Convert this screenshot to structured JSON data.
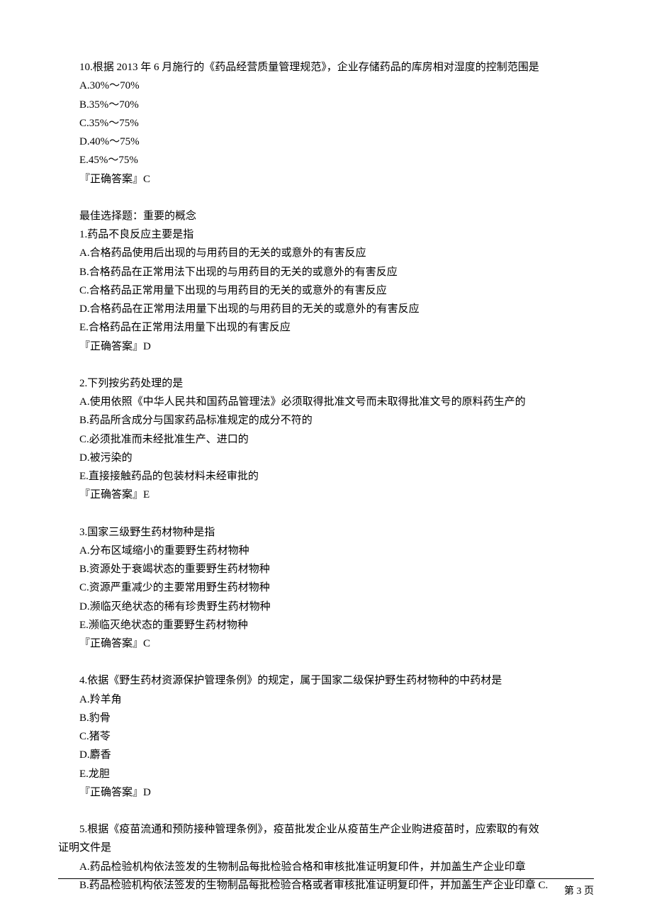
{
  "q10": {
    "stem": "10.根据 2013 年 6 月施行的《药品经营质量管理规范》，企业存储药品的库房相对湿度的控制范围是",
    "a": "A.30%～70%",
    "b": "B.35%～70%",
    "c": "C.35%～75%",
    "d": "D.40%～75%",
    "e": "E.45%～75%",
    "ans": "『正确答案』C"
  },
  "section_header": "最佳选择题：重要的概念",
  "q1": {
    "stem": "1.药品不良反应主要是指",
    "a": "A.合格药品使用后出现的与用药目的无关的或意外的有害反应",
    "b": "B.合格药品在正常用法下出现的与用药目的无关的或意外的有害反应",
    "c": "C.合格药品正常用量下出现的与用药目的无关的或意外的有害反应",
    "d": "D.合格药品在正常用法用量下出现的与用药目的无关的或意外的有害反应",
    "e": "E.合格药品在正常用法用量下出现的有害反应",
    "ans": "『正确答案』D"
  },
  "q2": {
    "stem": "2.下列按劣药处理的是",
    "a": "A.使用依照《中华人民共和国药品管理法》必须取得批准文号而未取得批准文号的原料药生产的",
    "b": "B.药品所含成分与国家药品标准规定的成分不符的",
    "c": "C.必须批准而未经批准生产、进口的",
    "d": "D.被污染的",
    "e": "E.直接接触药品的包装材料未经审批的",
    "ans": "『正确答案』E"
  },
  "q3": {
    "stem": "3.国家三级野生药材物种是指",
    "a": "A.分布区域缩小的重要野生药材物种",
    "b": "B.资源处于衰竭状态的重要野生药材物种",
    "c": "C.资源严重减少的主要常用野生药材物种",
    "d": "D.濒临灭绝状态的稀有珍贵野生药材物种",
    "e": "E.濒临灭绝状态的重要野生药材物种",
    "ans": "『正确答案』C"
  },
  "q4": {
    "stem": "4.依据《野生药材资源保护管理条例》的规定，属于国家二级保护野生药材物种的中药材是",
    "a": "A.羚羊角",
    "b": "B.豹骨",
    "c": "C.猪苓",
    "d": "D.麝香",
    "e": "E.龙胆",
    "ans": "『正确答案』D"
  },
  "q5": {
    "stem": "5.根据《疫苗流通和预防接种管理条例》，疫苗批发企业从疫苗生产企业购进疫苗时，应索取的有效",
    "stem2": "证明文件是",
    "a": "A.药品检验机构依法签发的生物制品每批检验合格和审核批准证明复印件，并加盖生产企业印章",
    "b": "B.药品检验机构依法签发的生物制品每批检验合格或者审核批准证明复印件，并加盖生产企业印章 C."
  },
  "page_label": "第 3 页"
}
